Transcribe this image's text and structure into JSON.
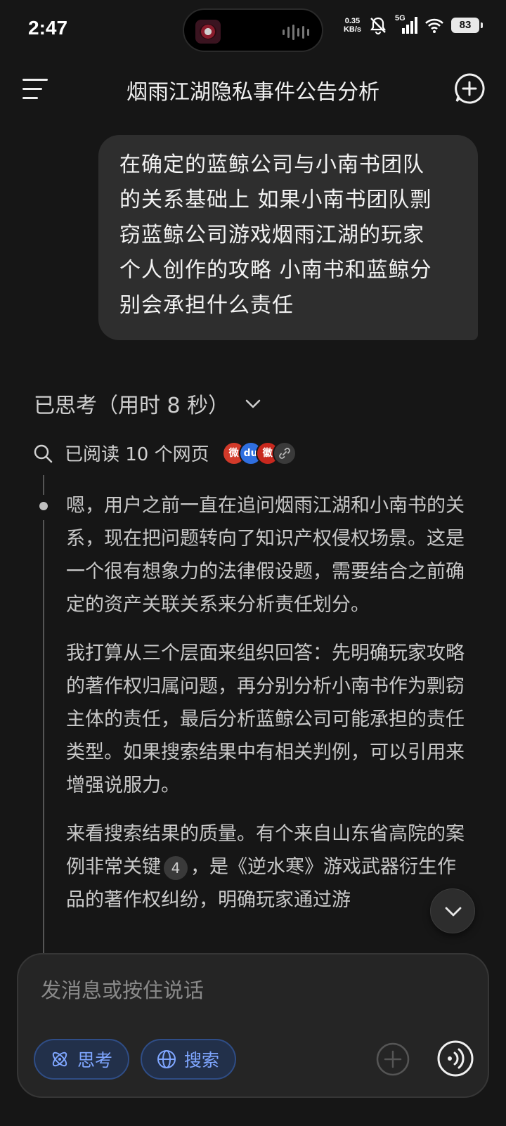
{
  "status_bar": {
    "time": "2:47",
    "net_speed_value": "0.35",
    "net_speed_unit": "KB/s",
    "network": "5G",
    "battery": "83"
  },
  "header": {
    "title": "烟雨江湖隐私事件公告分析"
  },
  "user_message": {
    "lines": [
      "在确定的蓝鲸公司与小南书团队",
      "的关系基础上 如果小南书团队剽",
      "窃蓝鲸公司游戏烟雨江湖的玩家",
      "个人创作的攻略 小南书和蓝鲸分",
      "别会承担什么责任"
    ]
  },
  "thinking": {
    "summary": "已思考（用时 8 秒）",
    "read_label": "已阅读 10 个网页",
    "sources": [
      {
        "icon": "source-weibo-icon",
        "glyph": "微",
        "color": "#d23a2a"
      },
      {
        "icon": "source-baidu-icon",
        "glyph": "du",
        "color": "#2f6fe0"
      },
      {
        "icon": "source-gov-icon",
        "glyph": "徽",
        "color": "#c8281e"
      },
      {
        "icon": "link-icon",
        "glyph": "🔗",
        "color": "#3a3a3a"
      }
    ],
    "paragraphs": {
      "p1": "嗯，用户之前一直在追问烟雨江湖和小南书的关系，现在把问题转向了知识产权侵权场景。这是一个很有想象力的法律假设题，需要结合之前确定的资产关联关系来分析责任划分。",
      "p2": "我打算从三个层面来组织回答：先明确玩家攻略的著作权归属问题，再分别分析小南书作为剽窃主体的责任，最后分析蓝鲸公司可能承担的责任类型。如果搜索结果中有相关判例，可以引用来增强说服力。",
      "p3_a": "来看搜索结果的质量。有个来自山东省高院的案例非常关键",
      "p3_cite": "4",
      "p3_b": "，是《逆水寒》游戏武器衍生作品的著作权纠纷，明确玩家通过游"
    }
  },
  "composer": {
    "placeholder": "发消息或按住说话",
    "think_label": "思考",
    "search_label": "搜索"
  }
}
